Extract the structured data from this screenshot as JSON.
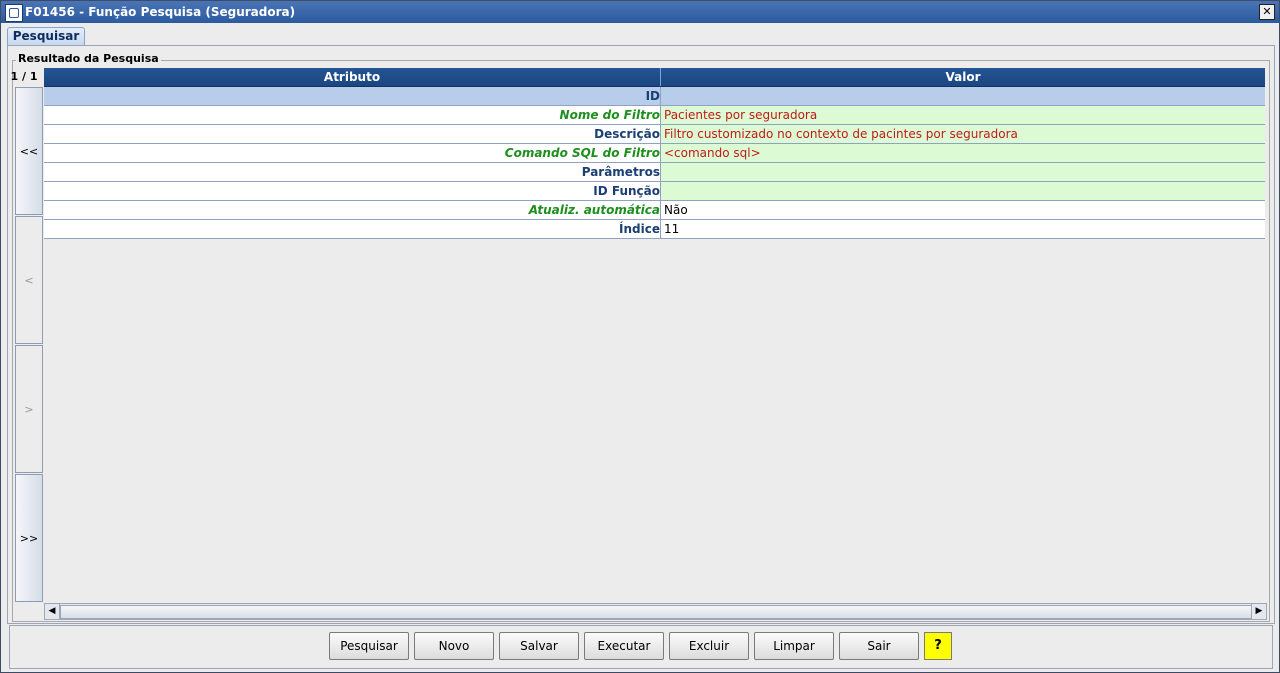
{
  "window": {
    "title": "F01456 - Função Pesquisa (Seguradora)",
    "close_glyph": "✕"
  },
  "tabs": [
    {
      "label": "Pesquisar"
    }
  ],
  "group": {
    "label": "Resultado da Pesquisa"
  },
  "pager": {
    "position": "1 / 1",
    "first": "<<",
    "prev": "<",
    "next": ">",
    "last": ">>"
  },
  "table": {
    "headers": {
      "attribute": "Atributo",
      "value": "Valor"
    },
    "rows": [
      {
        "attr": "ID",
        "value": ""
      },
      {
        "attr": "Nome do Filtro",
        "value": "Pacientes por seguradora"
      },
      {
        "attr": "Descrição",
        "value": "Filtro customizado no contexto de pacintes por seguradora"
      },
      {
        "attr": "Comando SQL do Filtro",
        "value": "<comando sql>"
      },
      {
        "attr": "Parâmetros",
        "value": ""
      },
      {
        "attr": "ID Função",
        "value": ""
      },
      {
        "attr": "Atualiz. automática",
        "value": "Não"
      },
      {
        "attr": "Índice",
        "value": "11"
      }
    ]
  },
  "scroll": {
    "left_glyph": "◀",
    "right_glyph": "▶"
  },
  "buttons": {
    "pesquisar": "Pesquisar",
    "novo": "Novo",
    "salvar": "Salvar",
    "executar": "Executar",
    "excluir": "Excluir",
    "limpar": "Limpar",
    "sair": "Sair",
    "help": "?"
  },
  "colors": {
    "title_bar": "#2c5aa0",
    "header": "#1b4680",
    "required_label": "#1d8f1d",
    "value_red": "#c21a1a",
    "editable_bg": "#dcfbd4",
    "help_bg": "#ffff00"
  }
}
